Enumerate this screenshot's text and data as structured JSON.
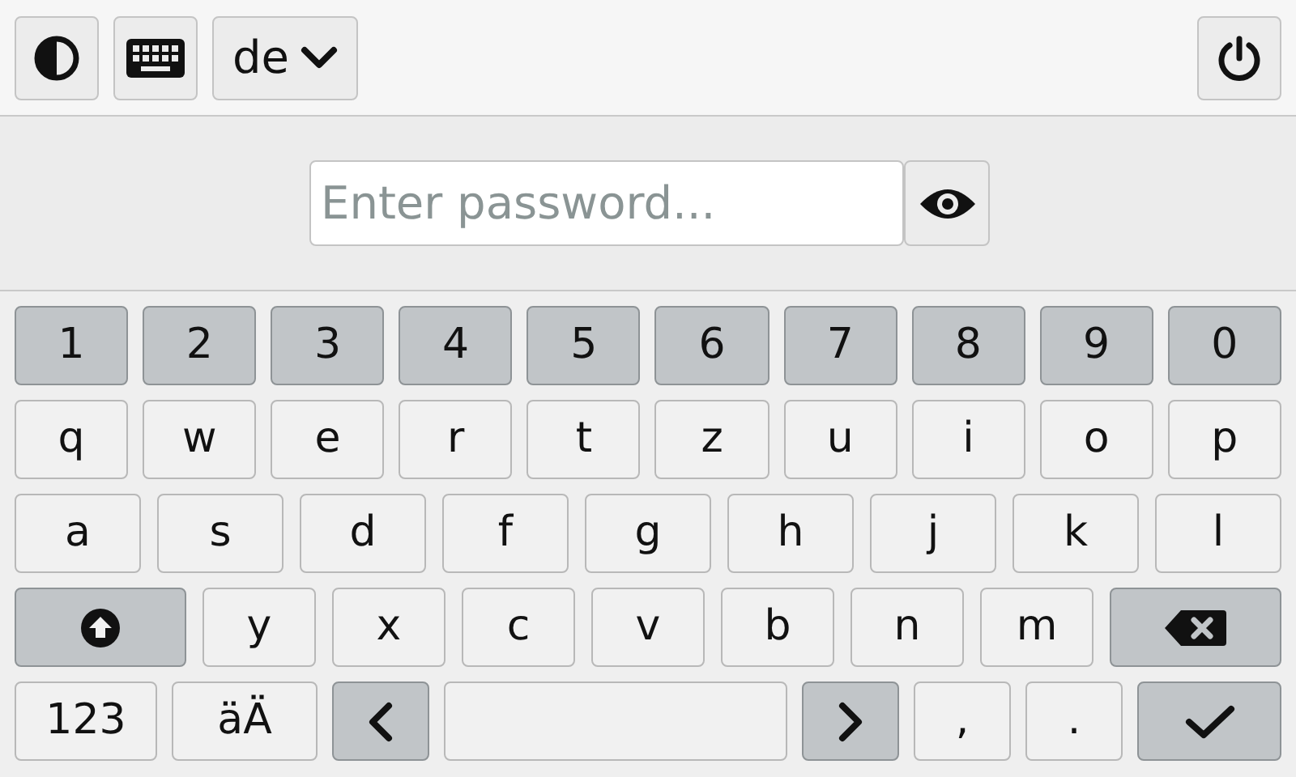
{
  "top_bar": {
    "language": {
      "label": "de"
    }
  },
  "password": {
    "placeholder": "Enter password..."
  },
  "keyboard": {
    "rows": [
      {
        "keys": [
          {
            "kind": "digit",
            "label": "1"
          },
          {
            "kind": "digit",
            "label": "2"
          },
          {
            "kind": "digit",
            "label": "3"
          },
          {
            "kind": "digit",
            "label": "4"
          },
          {
            "kind": "digit",
            "label": "5"
          },
          {
            "kind": "digit",
            "label": "6"
          },
          {
            "kind": "digit",
            "label": "7"
          },
          {
            "kind": "digit",
            "label": "8"
          },
          {
            "kind": "digit",
            "label": "9"
          },
          {
            "kind": "digit",
            "label": "0"
          }
        ]
      },
      {
        "keys": [
          {
            "kind": "letter",
            "label": "q"
          },
          {
            "kind": "letter",
            "label": "w"
          },
          {
            "kind": "letter",
            "label": "e"
          },
          {
            "kind": "letter",
            "label": "r"
          },
          {
            "kind": "letter",
            "label": "t"
          },
          {
            "kind": "letter",
            "label": "z"
          },
          {
            "kind": "letter",
            "label": "u"
          },
          {
            "kind": "letter",
            "label": "i"
          },
          {
            "kind": "letter",
            "label": "o"
          },
          {
            "kind": "letter",
            "label": "p"
          }
        ]
      },
      {
        "keys": [
          {
            "kind": "letter",
            "label": "a"
          },
          {
            "kind": "letter",
            "label": "s"
          },
          {
            "kind": "letter",
            "label": "d"
          },
          {
            "kind": "letter",
            "label": "f"
          },
          {
            "kind": "letter",
            "label": "g"
          },
          {
            "kind": "letter",
            "label": "h"
          },
          {
            "kind": "letter",
            "label": "j"
          },
          {
            "kind": "letter",
            "label": "k"
          },
          {
            "kind": "letter",
            "label": "l"
          }
        ]
      },
      {
        "keys": [
          {
            "kind": "shift"
          },
          {
            "kind": "letter",
            "label": "y"
          },
          {
            "kind": "letter",
            "label": "x"
          },
          {
            "kind": "letter",
            "label": "c"
          },
          {
            "kind": "letter",
            "label": "v"
          },
          {
            "kind": "letter",
            "label": "b"
          },
          {
            "kind": "letter",
            "label": "n"
          },
          {
            "kind": "letter",
            "label": "m"
          },
          {
            "kind": "backspace"
          }
        ]
      },
      {
        "keys": [
          {
            "kind": "mode",
            "label": "123"
          },
          {
            "kind": "mode",
            "label": "äÄ"
          },
          {
            "kind": "left"
          },
          {
            "kind": "space"
          },
          {
            "kind": "right"
          },
          {
            "kind": "punct",
            "label": ","
          },
          {
            "kind": "punct",
            "label": "."
          },
          {
            "kind": "enter"
          }
        ]
      }
    ]
  }
}
